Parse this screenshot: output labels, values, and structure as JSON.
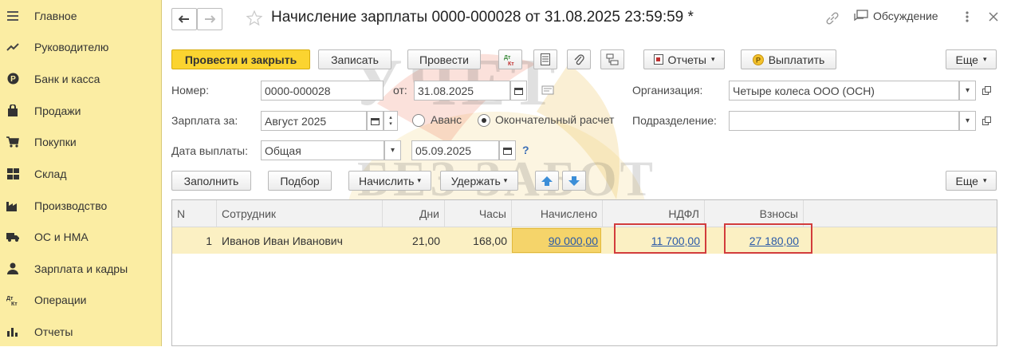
{
  "sidebar": {
    "items": [
      {
        "label": "Главное",
        "icon": "menu-icon"
      },
      {
        "label": "Руководителю",
        "icon": "trend-icon"
      },
      {
        "label": "Банк и касса",
        "icon": "coin-icon"
      },
      {
        "label": "Продажи",
        "icon": "bag-icon"
      },
      {
        "label": "Покупки",
        "icon": "cart-icon"
      },
      {
        "label": "Склад",
        "icon": "warehouse-icon"
      },
      {
        "label": "Производство",
        "icon": "factory-icon"
      },
      {
        "label": "ОС и НМА",
        "icon": "truck-icon"
      },
      {
        "label": "Зарплата и кадры",
        "icon": "person-icon"
      },
      {
        "label": "Операции",
        "icon": "dtkt-icon"
      },
      {
        "label": "Отчеты",
        "icon": "bar-chart-icon"
      }
    ]
  },
  "header": {
    "title": "Начисление зарплаты 0000-000028 от 31.08.2025 23:59:59 *",
    "discussion_label": "Обсуждение"
  },
  "toolbar": {
    "post_close_label": "Провести и закрыть",
    "save_label": "Записать",
    "post_label": "Провести",
    "dtkt_label": "Дт Кт",
    "reports_label": "Отчеты",
    "pay_label": "Выплатить",
    "more_label": "Еще"
  },
  "form": {
    "number_label": "Номер:",
    "number_value": "0000-000028",
    "date_label": "от:",
    "date_value": "31.08.2025",
    "org_label": "Организация:",
    "org_value": "Четыре колеса ООО (ОСН)",
    "salary_for_label": "Зарплата за:",
    "salary_for_value": "Август 2025",
    "advance_label": "Аванс",
    "final_label": "Окончательный расчет",
    "division_label": "Подразделение:",
    "division_value": "",
    "pay_date_label": "Дата выплаты:",
    "pay_date_type": "Общая",
    "pay_date_value": "05.09.2025",
    "help_label": "?"
  },
  "table_toolbar": {
    "fill_label": "Заполнить",
    "select_label": "Подбор",
    "accrue_label": "Начислить",
    "withhold_label": "Удержать",
    "more_label": "Еще"
  },
  "table": {
    "columns": [
      "N",
      "Сотрудник",
      "Дни",
      "Часы",
      "Начислено",
      "НДФЛ",
      "Взносы"
    ],
    "rows": [
      {
        "n": "1",
        "employee": "Иванов Иван Иванович",
        "days": "21,00",
        "hours": "168,00",
        "accrued": "90 000,00",
        "ndfl": "11 700,00",
        "contributions": "27 180,00"
      }
    ]
  },
  "watermark": {
    "line1": "УЧЕТ",
    "line2": "БЕЗ ЗАБОТ"
  },
  "colors": {
    "sidebar_bg": "#fbeda3",
    "primary_button": "#fbd430",
    "selected_row": "#fbf0c3",
    "highlight_border": "#d23c3c",
    "link": "#2a5aa8"
  }
}
